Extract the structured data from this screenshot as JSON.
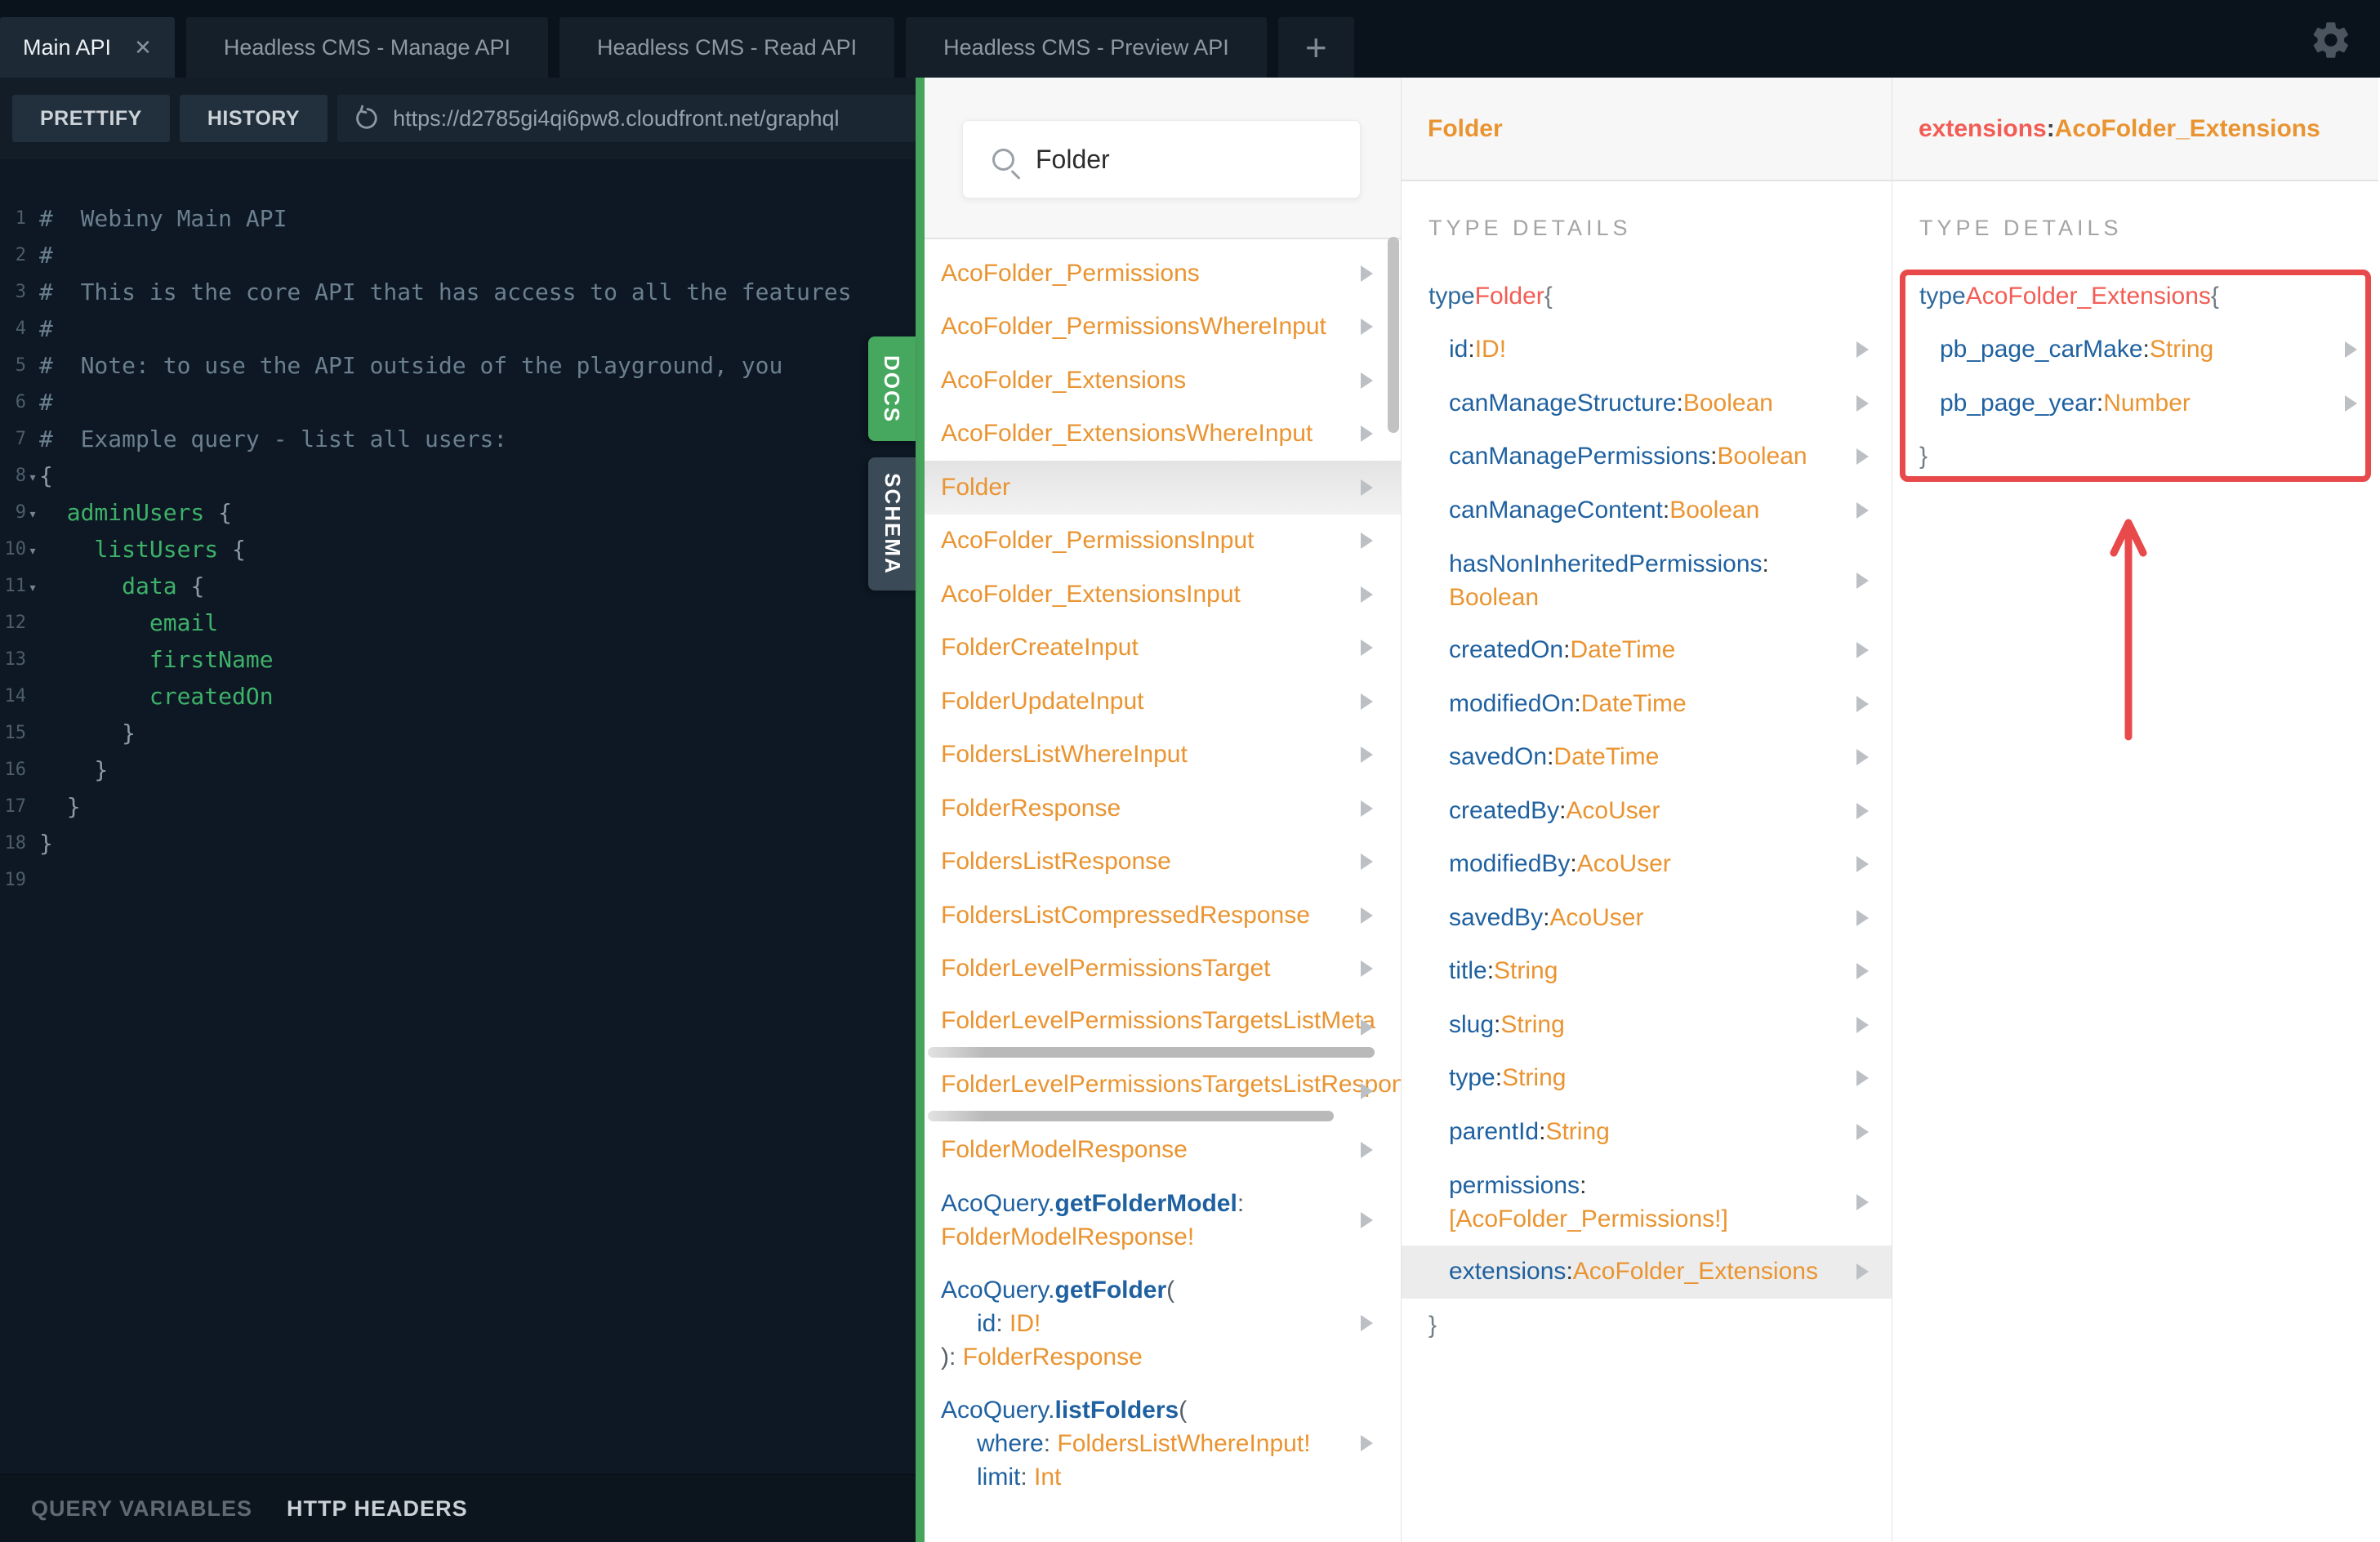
{
  "colors": {
    "green_divider": "#46a45c",
    "docs_tab_green": "#45a85e",
    "schema_tab_slate": "#3b4a57",
    "annotation_red": "#e8494a",
    "type_orange": "#ea9431",
    "field_blue": "#1f61a0",
    "selected_coral": "#f25c54",
    "editor_green": "#3eb169"
  },
  "icons": {
    "close": "✕",
    "plus": "+",
    "fold": "▾",
    "gear": "gear-icon",
    "reload": "reload-icon",
    "search": "search-icon",
    "row_arrow": "triangle-right"
  },
  "tabs": {
    "items": [
      {
        "label": "Main API",
        "active": true,
        "closable": true
      },
      {
        "label": "Headless CMS - Manage API",
        "active": false,
        "closable": false
      },
      {
        "label": "Headless CMS - Read API",
        "active": false,
        "closable": false
      },
      {
        "label": "Headless CMS - Preview API",
        "active": false,
        "closable": false
      }
    ],
    "new_tab": "+"
  },
  "toolbar": {
    "prettify": "PRETTIFY",
    "history": "HISTORY",
    "url": "https://d2785gi4qi6pw8.cloudfront.net/graphql"
  },
  "statusbar": {
    "query_variables": "QUERY VARIABLES",
    "http_headers": "HTTP HEADERS"
  },
  "side_tabs": {
    "docs": "DOCS",
    "schema": "SCHEMA"
  },
  "editor": {
    "lines": [
      {
        "n": "1",
        "fold": false,
        "seg": [
          {
            "c": "cmt",
            "t": "#  Webiny Main API"
          }
        ]
      },
      {
        "n": "2",
        "fold": false,
        "seg": [
          {
            "c": "cmt",
            "t": "#"
          }
        ]
      },
      {
        "n": "3",
        "fold": false,
        "seg": [
          {
            "c": "cmt",
            "t": "#  This is the core API that has access to all the features"
          }
        ]
      },
      {
        "n": "4",
        "fold": false,
        "seg": [
          {
            "c": "cmt",
            "t": "#"
          }
        ]
      },
      {
        "n": "5",
        "fold": false,
        "seg": [
          {
            "c": "cmt",
            "t": "#  Note: to use the API outside of the playground, you "
          }
        ]
      },
      {
        "n": "6",
        "fold": false,
        "seg": [
          {
            "c": "cmt",
            "t": "#"
          }
        ]
      },
      {
        "n": "7",
        "fold": false,
        "seg": [
          {
            "c": "cmt",
            "t": "#  Example query - list all users:"
          }
        ]
      },
      {
        "n": "8",
        "fold": true,
        "seg": [
          {
            "c": "pn",
            "t": "{"
          }
        ]
      },
      {
        "n": "9",
        "fold": true,
        "seg": [
          {
            "c": "pn",
            "t": "  "
          },
          {
            "c": "fld",
            "t": "adminUsers"
          },
          {
            "c": "pn",
            "t": " {"
          }
        ]
      },
      {
        "n": "10",
        "fold": true,
        "seg": [
          {
            "c": "pn",
            "t": "    "
          },
          {
            "c": "fld",
            "t": "listUsers"
          },
          {
            "c": "pn",
            "t": " {"
          }
        ]
      },
      {
        "n": "11",
        "fold": true,
        "seg": [
          {
            "c": "pn",
            "t": "      "
          },
          {
            "c": "fld",
            "t": "data"
          },
          {
            "c": "pn",
            "t": " {"
          }
        ]
      },
      {
        "n": "12",
        "fold": false,
        "seg": [
          {
            "c": "pn",
            "t": "        "
          },
          {
            "c": "fld",
            "t": "email"
          }
        ]
      },
      {
        "n": "13",
        "fold": false,
        "seg": [
          {
            "c": "pn",
            "t": "        "
          },
          {
            "c": "fld",
            "t": "firstName"
          }
        ]
      },
      {
        "n": "14",
        "fold": false,
        "seg": [
          {
            "c": "pn",
            "t": "        "
          },
          {
            "c": "fld",
            "t": "createdOn"
          }
        ]
      },
      {
        "n": "15",
        "fold": false,
        "seg": [
          {
            "c": "pn",
            "t": "      }"
          }
        ]
      },
      {
        "n": "16",
        "fold": false,
        "seg": [
          {
            "c": "pn",
            "t": "    }"
          }
        ]
      },
      {
        "n": "17",
        "fold": false,
        "seg": [
          {
            "c": "pn",
            "t": "  }"
          }
        ]
      },
      {
        "n": "18",
        "fold": false,
        "seg": [
          {
            "c": "pn",
            "t": "}"
          }
        ]
      },
      {
        "n": "19",
        "fold": false,
        "seg": []
      }
    ]
  },
  "docs": {
    "search": {
      "value": "Folder",
      "placeholder": ""
    },
    "items": [
      {
        "t": "AcoFolder_Permissions"
      },
      {
        "t": "AcoFolder_PermissionsWhereInput"
      },
      {
        "t": "AcoFolder_Extensions"
      },
      {
        "t": "AcoFolder_ExtensionsWhereInput"
      },
      {
        "t": "Folder",
        "selected": true
      },
      {
        "t": "AcoFolder_PermissionsInput"
      },
      {
        "t": "AcoFolder_ExtensionsInput"
      },
      {
        "t": "FolderCreateInput"
      },
      {
        "t": "FolderUpdateInput"
      },
      {
        "t": "FoldersListWhereInput"
      },
      {
        "t": "FolderResponse"
      },
      {
        "t": "FoldersListResponse"
      },
      {
        "t": "FoldersListCompressedResponse"
      },
      {
        "t": "FolderLevelPermissionsTarget"
      },
      {
        "t": "FolderLevelPermissionsTargetsListMeta",
        "hs": 1
      },
      {
        "t": "FolderLevelPermissionsTargetsListResponse",
        "hs": 2
      },
      {
        "t": "FolderModelResponse"
      },
      {
        "lines": [
          {
            "ind": false,
            "seg": [
              {
                "c": "b",
                "t": "AcoQuery."
              },
              {
                "c": "bb",
                "t": "getFolderModel"
              },
              {
                "c": "p",
                "t": ":"
              }
            ]
          },
          {
            "ind": false,
            "seg": [
              {
                "c": "o",
                "t": "FolderModelResponse!"
              }
            ]
          }
        ]
      },
      {
        "lines": [
          {
            "ind": false,
            "seg": [
              {
                "c": "b",
                "t": "AcoQuery."
              },
              {
                "c": "bb",
                "t": "getFolder"
              },
              {
                "c": "p",
                "t": "("
              }
            ]
          },
          {
            "ind": true,
            "seg": [
              {
                "c": "b",
                "t": "id"
              },
              {
                "c": "p",
                "t": ": "
              },
              {
                "c": "o",
                "t": "ID!"
              }
            ]
          },
          {
            "ind": false,
            "seg": [
              {
                "c": "p",
                "t": "): "
              },
              {
                "c": "o",
                "t": "FolderResponse"
              }
            ]
          }
        ]
      },
      {
        "lines": [
          {
            "ind": false,
            "seg": [
              {
                "c": "b",
                "t": "AcoQuery."
              },
              {
                "c": "bb",
                "t": "listFolders"
              },
              {
                "c": "p",
                "t": "("
              }
            ]
          },
          {
            "ind": true,
            "seg": [
              {
                "c": "b",
                "t": "where"
              },
              {
                "c": "p",
                "t": ": "
              },
              {
                "c": "o",
                "t": "FoldersListWhereInput!"
              }
            ]
          },
          {
            "ind": true,
            "seg": [
              {
                "c": "b",
                "t": "limit"
              },
              {
                "c": "p",
                "t": ": "
              },
              {
                "c": "o",
                "t": "Int"
              }
            ]
          }
        ]
      }
    ]
  },
  "type_panel": {
    "title": "Folder",
    "section": "TYPE DETAILS",
    "decl": [
      {
        "c": "kw",
        "t": "type "
      },
      {
        "c": "tn",
        "t": "Folder"
      },
      {
        "c": "br",
        "t": " {"
      }
    ],
    "fields": [
      {
        "name": "id",
        "type": "ID!"
      },
      {
        "name": "canManageStructure",
        "type": "Boolean"
      },
      {
        "name": "canManagePermissions",
        "type": "Boolean"
      },
      {
        "name": "canManageContent",
        "type": "Boolean"
      },
      {
        "name": "hasNonInheritedPermissions",
        "type": "Boolean",
        "wrap": true
      },
      {
        "name": "createdOn",
        "type": "DateTime"
      },
      {
        "name": "modifiedOn",
        "type": "DateTime"
      },
      {
        "name": "savedOn",
        "type": "DateTime"
      },
      {
        "name": "createdBy",
        "type": "AcoUser"
      },
      {
        "name": "modifiedBy",
        "type": "AcoUser"
      },
      {
        "name": "savedBy",
        "type": "AcoUser"
      },
      {
        "name": "title",
        "type": "String"
      },
      {
        "name": "slug",
        "type": "String"
      },
      {
        "name": "type",
        "type": "String"
      },
      {
        "name": "parentId",
        "type": "String"
      },
      {
        "name": "permissions",
        "type": "[AcoFolder_Permissions!]",
        "wrap": true
      },
      {
        "name": "extensions",
        "type": "AcoFolder_Extensions",
        "selected": true
      }
    ],
    "close": "}"
  },
  "ext_panel": {
    "title_field": "extensions",
    "title_colon": ": ",
    "title_type": "AcoFolder_Extensions",
    "section": "TYPE DETAILS",
    "decl": [
      {
        "c": "kw",
        "t": "type "
      },
      {
        "c": "tn",
        "t": "AcoFolder_Extensions"
      },
      {
        "c": "br",
        "t": " {"
      }
    ],
    "fields": [
      {
        "name": "pb_page_carMake",
        "type": "String"
      },
      {
        "name": "pb_page_year",
        "type": "Number"
      }
    ],
    "close": "}"
  }
}
